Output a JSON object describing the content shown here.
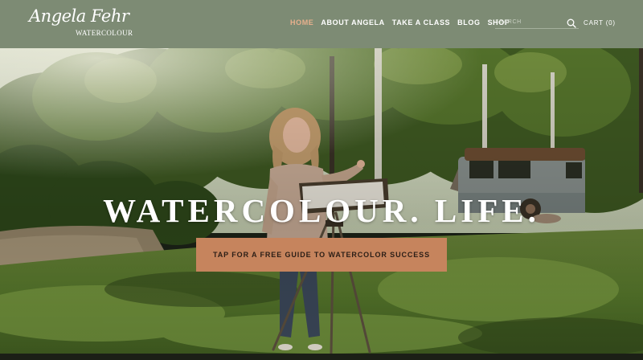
{
  "brand": {
    "script": "Angela Fehr",
    "subtitle": "WATERCOLOUR"
  },
  "nav": {
    "items": [
      {
        "label": "HOME",
        "active": true
      },
      {
        "label": "ABOUT ANGELA",
        "active": false
      },
      {
        "label": "TAKE A CLASS",
        "active": false
      },
      {
        "label": "BLOG",
        "active": false
      },
      {
        "label": "SHOP",
        "active": false
      }
    ]
  },
  "search": {
    "placeholder": "SEARCH",
    "icon": "search-icon"
  },
  "cart": {
    "label": "CART (0)"
  },
  "hero": {
    "headline": "WATERCOLOUR. LIFE.",
    "cta_label": "TAP FOR A FREE GUIDE TO WATERCOLOR SUCCESS"
  },
  "colors": {
    "header_bg": "#7d8b74",
    "active_nav": "#e7b08d",
    "cta_bg": "#c6845d",
    "text_light": "#ffffff"
  }
}
